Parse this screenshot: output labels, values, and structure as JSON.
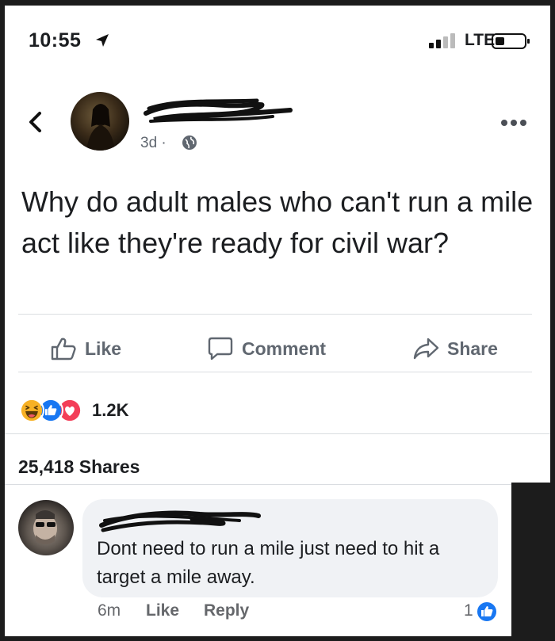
{
  "status_bar": {
    "time": "10:55",
    "carrier": "LTE",
    "icons": [
      "location-arrow-icon",
      "signal-bars-icon",
      "battery-icon"
    ]
  },
  "post": {
    "time_ago": "3d ·",
    "privacy_icon": "globe-icon",
    "text": "Why do adult males who can't run a mile act like they're ready for civil war?",
    "actions": {
      "like": "Like",
      "comment": "Comment",
      "share": "Share"
    },
    "reactions": {
      "types": [
        "haha",
        "like",
        "love"
      ],
      "count": "1.2K"
    },
    "shares": "25,418 Shares"
  },
  "comment": {
    "text": "Dont need to run a mile just need to hit a target a mile away.",
    "time_ago": "6m",
    "like_label": "Like",
    "reply_label": "Reply",
    "like_count": "1"
  },
  "colors": {
    "like_blue": "#1877f2",
    "love_red": "#f33e58",
    "haha_yellow": "#f7b125",
    "muted_text": "#606770"
  }
}
